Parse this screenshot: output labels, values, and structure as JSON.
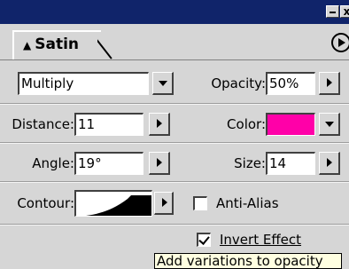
{
  "title_bar": {
    "close_glyph": "x"
  },
  "tab": {
    "label": "Satin"
  },
  "blend_mode": {
    "value": "Multiply"
  },
  "opacity": {
    "label": "Opacity:",
    "value": "50%"
  },
  "distance": {
    "label": "Distance:",
    "value": "11"
  },
  "color": {
    "label": "Color:",
    "swatch": "#ff00a8"
  },
  "angle": {
    "label": "Angle:",
    "value": "19°"
  },
  "size": {
    "label": "Size:",
    "value": "14"
  },
  "contour": {
    "label": "Contour:"
  },
  "anti_alias": {
    "label": "Anti-Alias",
    "checked": false
  },
  "invert": {
    "label": "Invert Effect",
    "checked": true
  },
  "tooltip": {
    "text": "Add variations to opacity"
  }
}
